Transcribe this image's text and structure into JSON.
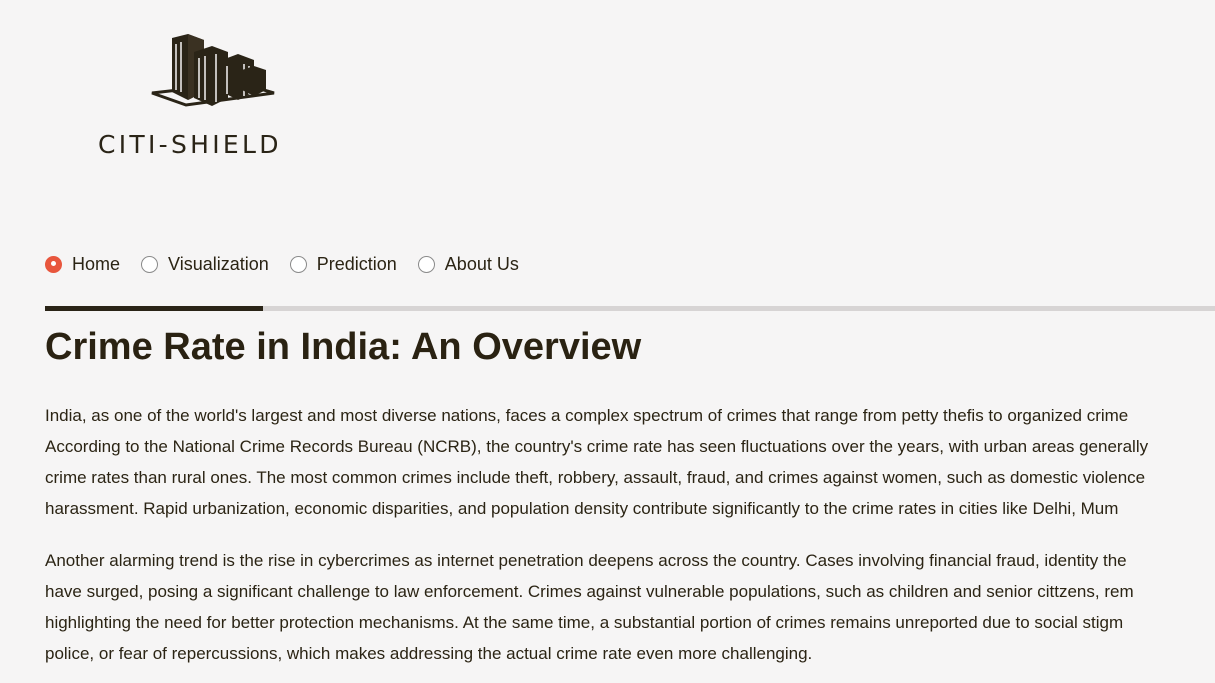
{
  "brand": {
    "name": "CITI-SHIELD",
    "logo_icon": "city-buildings-icon"
  },
  "nav": {
    "items": [
      {
        "label": "Home",
        "selected": true
      },
      {
        "label": "Visualization",
        "selected": false
      },
      {
        "label": "Prediction",
        "selected": false
      },
      {
        "label": "About Us",
        "selected": false
      }
    ]
  },
  "main": {
    "title": "Crime Rate in India: An Overview",
    "paragraphs": [
      {
        "lines": [
          "India, as one of the world's largest and most diverse nations, faces a complex spectrum of crimes that range from petty thefis to organized crime",
          "According to the National Crime Records Bureau (NCRB), the country's crime rate has seen fluctuations over the years, with urban areas generally",
          "crime rates than rural ones. The most common crimes include theft, robbery, assault, fraud, and crimes against women, such as domestic violence",
          "harassment. Rapid urbanization, economic disparities, and population density contribute significantly to the crime rates in cities like Delhi, Mum"
        ]
      },
      {
        "lines": [
          "Another alarming trend is the rise in cybercrimes as internet penetration deepens across the country. Cases involving financial fraud, identity the",
          "have surged, posing a significant challenge to law enforcement. Crimes against vulnerable populations, such as children and senior cittzens, rem",
          "highlighting the need for better protection mechanisms. At the same time, a substantial portion of crimes remains unreported due to social stigm",
          "police, or fear of repercussions, which makes addressing the actual crime rate even more challenging."
        ]
      }
    ]
  },
  "colors": {
    "accent": "#e8563d",
    "text": "#2b2414",
    "rule": "#d7d4d4",
    "rule_active": "#2a2417",
    "background": "#f6f5f5"
  }
}
